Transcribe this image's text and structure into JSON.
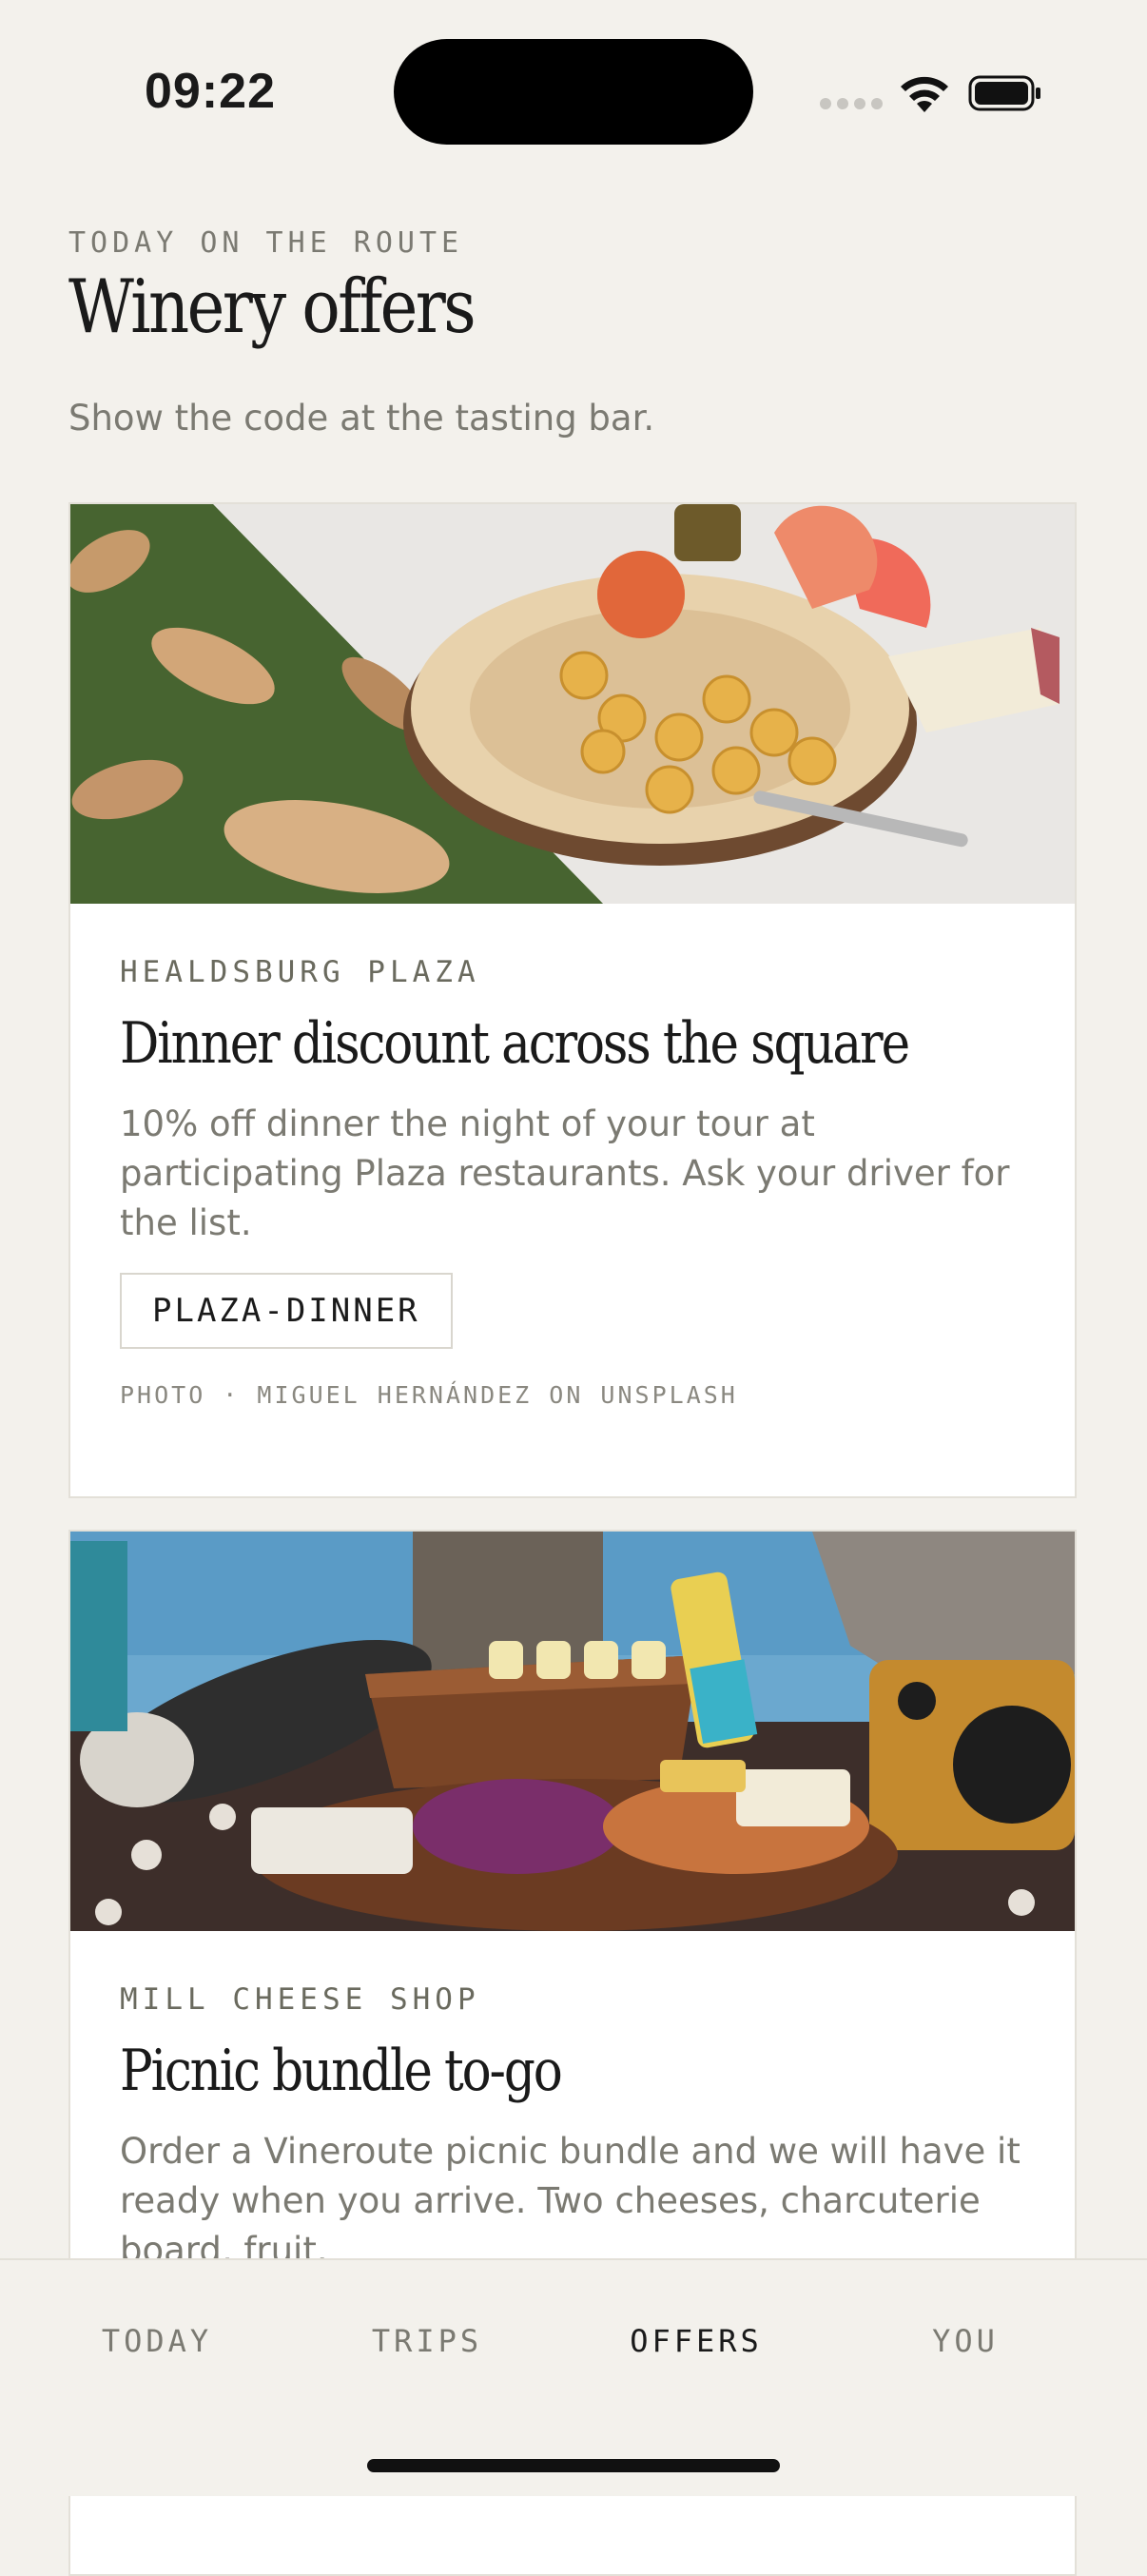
{
  "status_bar": {
    "time": "09:22"
  },
  "header": {
    "kicker": "TODAY ON THE ROUTE",
    "title": "Winery offers",
    "subtitle": "Show the code at the tasting bar."
  },
  "offers": [
    {
      "location": "HEALDSBURG PLAZA",
      "title": "Dinner discount across the square",
      "description": "10% off dinner the night of your tour at participating Plaza restaurants. Ask your driver for the list.",
      "code": "PLAZA-DINNER",
      "photo_credit": "PHOTO · MIGUEL HERNÁNDEZ ON UNSPLASH"
    },
    {
      "location": "MILL CHEESE SHOP",
      "title": "Picnic bundle to-go",
      "description": "Order a Vineroute picnic bundle and we will have it ready when you arrive. Two cheeses, charcuterie board, fruit."
    }
  ],
  "tabs": [
    {
      "label": "TODAY",
      "active": false
    },
    {
      "label": "TRIPS",
      "active": false
    },
    {
      "label": "OFFERS",
      "active": true
    },
    {
      "label": "YOU",
      "active": false
    }
  ],
  "colors": {
    "background": "#f3f1ec",
    "card": "#ffffff",
    "muted_text": "#7b7a72",
    "ink": "#1a1a1a"
  }
}
